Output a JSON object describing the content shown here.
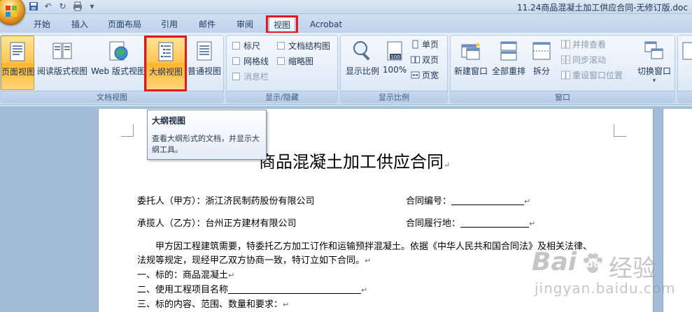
{
  "window": {
    "title": "11.24商品混凝土加工供应合同-无修订版.doc"
  },
  "tabs": [
    {
      "label": "开始"
    },
    {
      "label": "插入"
    },
    {
      "label": "页面布局"
    },
    {
      "label": "引用"
    },
    {
      "label": "邮件"
    },
    {
      "label": "审阅"
    },
    {
      "label": "视图"
    },
    {
      "label": "Acrobat"
    }
  ],
  "ribbon": {
    "doc_views": {
      "label": "文档视图",
      "buttons": [
        "页面视图",
        "阅读版式视图",
        "Web 版式视图",
        "大纲视图",
        "普通视图"
      ]
    },
    "show_hide": {
      "label": "显示/隐藏",
      "items": [
        "标尺",
        "文档结构图",
        "网格线",
        "缩略图",
        "消息栏"
      ]
    },
    "zoom": {
      "label": "显示比例",
      "zoom_label": "显示比例",
      "pct_label": "100%",
      "pct_icon_text": "100",
      "items": [
        "单页",
        "双页",
        "页宽"
      ]
    },
    "window": {
      "label": "窗口",
      "new_window": "新建窗口",
      "arrange_all": "全部重排",
      "split": "拆分",
      "side_by_side": "并排查看",
      "sync_scroll": "同步滚动",
      "reset_pos": "重设窗口位置",
      "switch": "切换窗口"
    }
  },
  "tooltip": {
    "title": "大纲视图",
    "body": "查看大纲形式的文档，并显示大纲工具。"
  },
  "document": {
    "heading": "商品混凝土加工供应合同",
    "lines": {
      "l1a": "委托人（甲方）：浙江济民制药股份有限公司",
      "l1b": "合同编号：",
      "l2a": "承揽人（乙方）：台州正方建材有限公司",
      "l2b": "合同履行地：",
      "l3": "甲方因工程建筑需要，特委托乙方加工订作和运输预拌混凝土。依据《中华人民共和国合同法》及相关法律、",
      "l4": "法规等规定，现经甲乙双方协商一致，特订立如下合同。",
      "l5": "一、标的：商品混凝土",
      "l6": "二、使用工程项目名称",
      "l7": "三、标的内容、范围、数量和要求："
    },
    "para_mark": "↵"
  },
  "watermark": {
    "brand": "Bai",
    "paw": "du",
    "cn": "经验",
    "url": "jingyan.baidu.com"
  },
  "colors": {
    "highlight_red": "#e8141e",
    "ribbon_blue": "#d7e5f5",
    "active_orange": "#ffc44f"
  }
}
